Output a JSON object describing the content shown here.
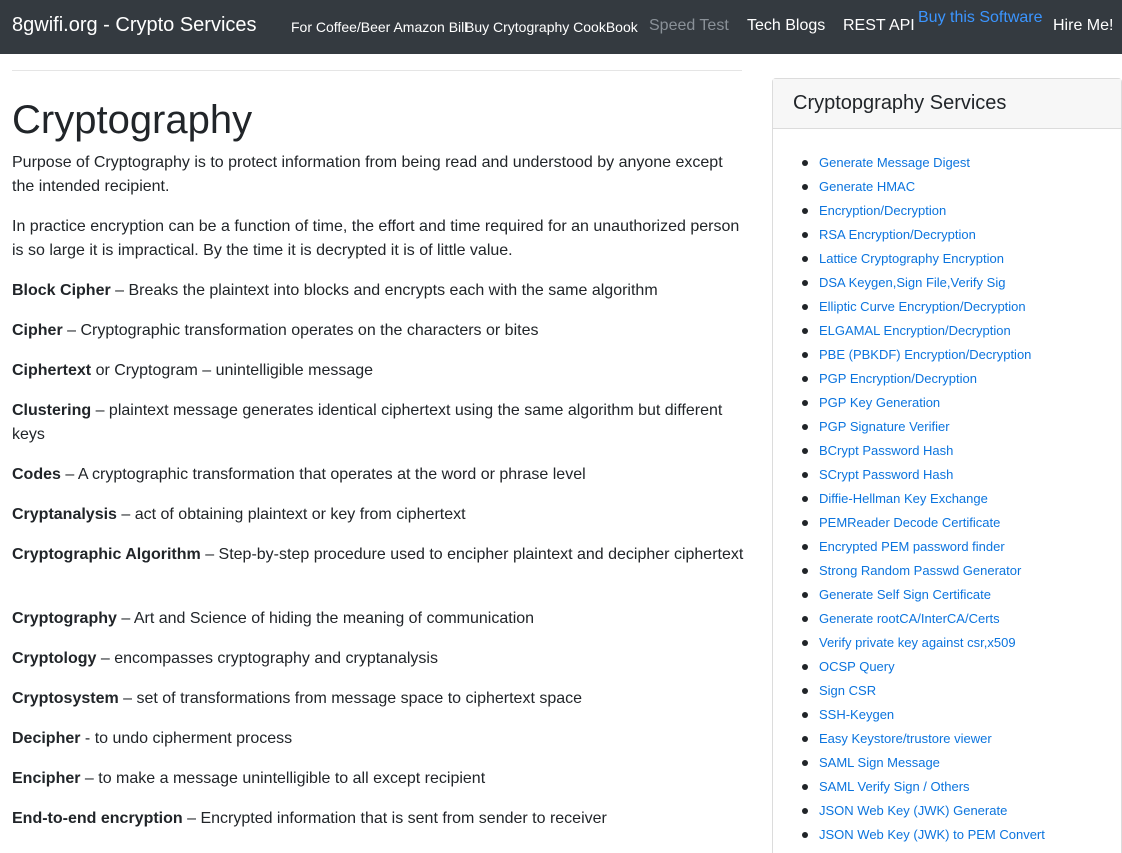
{
  "navbar": {
    "brand": "8gwifi.org - Crypto Services",
    "links": {
      "coffee": "For Coffee/Beer Amazon Bill",
      "cookbook": "Buy Crytography CookBook",
      "speed_test": "Speed Test",
      "tech_blogs": "Tech Blogs",
      "rest_api": "REST API",
      "buy_software": "Buy this Software",
      "hire_me": "Hire Me!"
    }
  },
  "main": {
    "title": "Cryptography",
    "intro": [
      "Purpose of Cryptography is to protect information from being read and understood by anyone except the intended recipient.",
      "In practice encryption can be a function of time, the effort and time required for an unauthorized person is so large it is impractical.  By the time it is decrypted it is of little value."
    ],
    "terms": [
      {
        "term": "Block Cipher",
        "def": " – Breaks the plaintext into blocks and encrypts each with the same algorithm"
      },
      {
        "term": "Cipher",
        "def": " – Cryptographic transformation operates on the characters or bites"
      },
      {
        "term": "Ciphertext",
        "def": " or Cryptogram – unintelligible message"
      },
      {
        "term": "Clustering",
        "def": " – plaintext message generates identical ciphertext using the same algorithm but different keys"
      },
      {
        "term": "Codes",
        "def": " – A cryptographic transformation that operates at the word or phrase level"
      },
      {
        "term": "Cryptanalysis",
        "def": " – act of obtaining plaintext or key from ciphertext"
      },
      {
        "term": "Cryptographic Algorithm",
        "def": " – Step-by-step procedure used to encipher plaintext and decipher ciphertext"
      },
      {
        "term": "Cryptography",
        "def": " – Art and Science of hiding the meaning of communication"
      },
      {
        "term": "Cryptology",
        "def": " – encompasses cryptography and cryptanalysis"
      },
      {
        "term": "Cryptosystem",
        "def": " – set of transformations from message space to ciphertext space"
      },
      {
        "term": "Decipher",
        "def": " - to undo cipherment process"
      },
      {
        "term": "Encipher",
        "def": " – to make a message unintelligible to all except recipient"
      },
      {
        "term": "End-to-end encryption",
        "def": " – Encrypted information that is sent from sender to receiver"
      }
    ]
  },
  "sidebar": {
    "title": "Cryptopgraphy Services",
    "items": [
      "Generate Message Digest",
      "Generate HMAC",
      "Encryption/Decryption",
      "RSA Encryption/Decryption",
      "Lattice Cryptography Encryption",
      "DSA Keygen,Sign File,Verify Sig",
      "Elliptic Curve Encryption/Decryption",
      "ELGAMAL Encryption/Decryption",
      "PBE (PBKDF) Encryption/Decryption",
      "PGP Encryption/Decryption",
      "PGP Key Generation",
      "PGP Signature Verifier",
      "BCrypt Password Hash",
      "SCrypt Password Hash",
      "Diffie-Hellman Key Exchange",
      "PEMReader Decode Certificate",
      "Encrypted PEM password finder",
      "Strong Random Passwd Generator",
      "Generate Self Sign Certificate",
      "Generate rootCA/InterCA/Certs",
      "Verify private key against csr,x509",
      "OCSP Query",
      "Sign CSR",
      "SSH-Keygen",
      "Easy Keystore/trustore viewer",
      "SAML Sign Message",
      "SAML Verify Sign / Others",
      "JSON Web Key (JWK) Generate",
      "JSON Web Key (JWK) to PEM Convert"
    ]
  },
  "colors": {
    "navbar_bg": "#343a40",
    "link_blue": "#0b74de",
    "nav_highlight": "#3b95ff"
  }
}
